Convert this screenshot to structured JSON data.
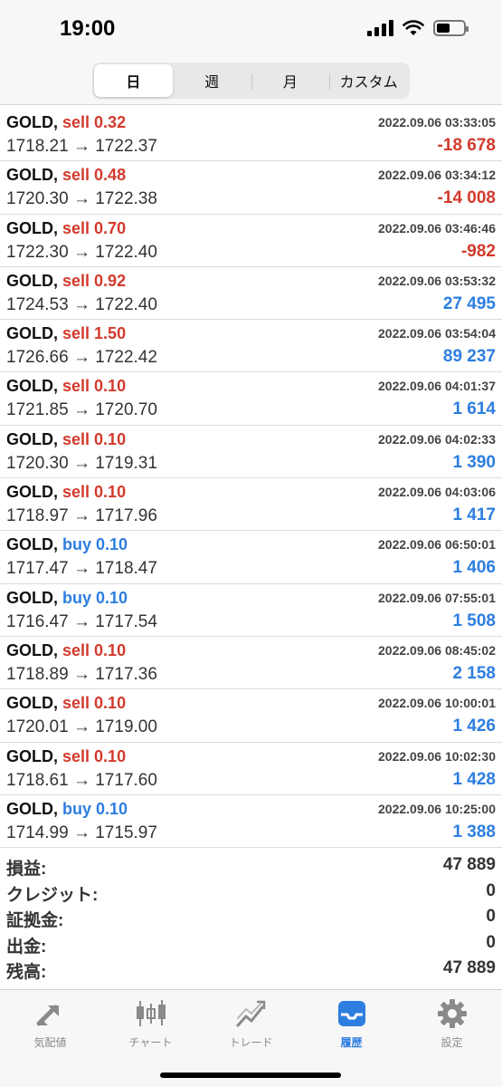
{
  "status_bar": {
    "time": "19:00",
    "battery_level": 0.5
  },
  "segment": {
    "tabs": [
      {
        "label": "日",
        "active": true
      },
      {
        "label": "週",
        "active": false
      },
      {
        "label": "月",
        "active": false
      },
      {
        "label": "カスタム",
        "active": false
      }
    ]
  },
  "deals": [
    {
      "symbol": "GOLD,",
      "side": "sell 0.32",
      "time": "2022.09.06 03:33:05",
      "prices": "1718.21 → 1722.37",
      "profit": "-18 678"
    },
    {
      "symbol": "GOLD,",
      "side": "sell 0.48",
      "time": "2022.09.06 03:34:12",
      "prices": "1720.30 → 1722.38",
      "profit": "-14 008"
    },
    {
      "symbol": "GOLD,",
      "side": "sell 0.70",
      "time": "2022.09.06 03:46:46",
      "prices": "1722.30 → 1722.40",
      "profit": "-982"
    },
    {
      "symbol": "GOLD,",
      "side": "sell 0.92",
      "time": "2022.09.06 03:53:32",
      "prices": "1724.53 → 1722.40",
      "profit": "27 495"
    },
    {
      "symbol": "GOLD,",
      "side": "sell 1.50",
      "time": "2022.09.06 03:54:04",
      "prices": "1726.66 → 1722.42",
      "profit": "89 237"
    },
    {
      "symbol": "GOLD,",
      "side": "sell 0.10",
      "time": "2022.09.06 04:01:37",
      "prices": "1721.85 → 1720.70",
      "profit": "1 614"
    },
    {
      "symbol": "GOLD,",
      "side": "sell 0.10",
      "time": "2022.09.06 04:02:33",
      "prices": "1720.30 → 1719.31",
      "profit": "1 390"
    },
    {
      "symbol": "GOLD,",
      "side": "sell 0.10",
      "time": "2022.09.06 04:03:06",
      "prices": "1718.97 → 1717.96",
      "profit": "1 417"
    },
    {
      "symbol": "GOLD,",
      "side": "buy 0.10",
      "time": "2022.09.06 06:50:01",
      "prices": "1717.47 → 1718.47",
      "profit": "1 406"
    },
    {
      "symbol": "GOLD,",
      "side": "buy 0.10",
      "time": "2022.09.06 07:55:01",
      "prices": "1716.47 → 1717.54",
      "profit": "1 508"
    },
    {
      "symbol": "GOLD,",
      "side": "sell 0.10",
      "time": "2022.09.06 08:45:02",
      "prices": "1718.89 → 1717.36",
      "profit": "2 158"
    },
    {
      "symbol": "GOLD,",
      "side": "sell 0.10",
      "time": "2022.09.06 10:00:01",
      "prices": "1720.01 → 1719.00",
      "profit": "1 426"
    },
    {
      "symbol": "GOLD,",
      "side": "sell 0.10",
      "time": "2022.09.06 10:02:30",
      "prices": "1718.61 → 1717.60",
      "profit": "1 428"
    },
    {
      "symbol": "GOLD,",
      "side": "buy 0.10",
      "time": "2022.09.06 10:25:00",
      "prices": "1714.99 → 1715.97",
      "profit": "1 388"
    }
  ],
  "summary": [
    {
      "label": "損益:",
      "value": "47 889"
    },
    {
      "label": "クレジット:",
      "value": "0"
    },
    {
      "label": "証拠金:",
      "value": "0"
    },
    {
      "label": "出金:",
      "value": "0"
    },
    {
      "label": "残高:",
      "value": "47 889"
    }
  ],
  "tabbar": [
    {
      "label": "気配値",
      "icon": "quotes-arrows-icon",
      "active": false
    },
    {
      "label": "チャート",
      "icon": "candlestick-chart-icon",
      "active": false
    },
    {
      "label": "トレード",
      "icon": "trade-line-chart-icon",
      "active": false
    },
    {
      "label": "履歴",
      "icon": "history-inbox-icon",
      "active": true
    },
    {
      "label": "設定",
      "icon": "gear-icon",
      "active": false
    }
  ],
  "colors": {
    "sell": "#d23a2c",
    "buy": "#2d7ee0",
    "negative": "#d23a2c",
    "positive": "#2d7ee0",
    "tab_active": "#2d7ee0",
    "tab_inactive": "#8a8a8a"
  }
}
